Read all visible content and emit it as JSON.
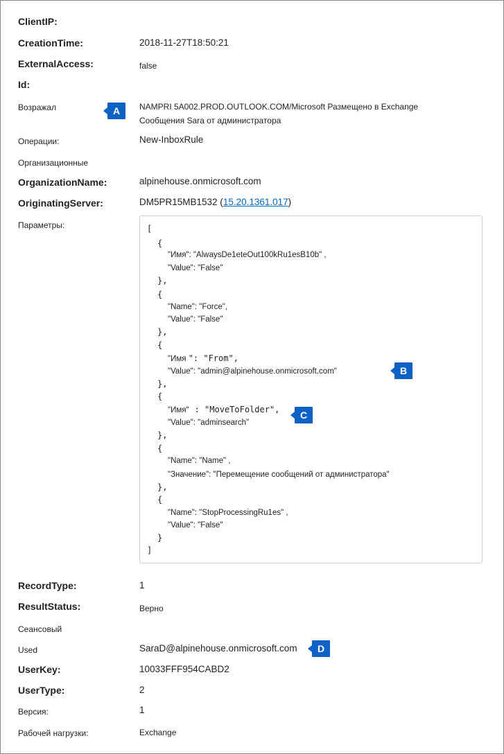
{
  "properties": {
    "client_ip": {
      "label": "ClientIP:"
    },
    "creation_time": {
      "label": "CreationTime:",
      "value": "2018-11-27T18:50:21"
    },
    "external_access": {
      "label": "ExternalAccess:",
      "value": "false"
    },
    "id": {
      "label": "Id:"
    },
    "objected": {
      "label": "Возражал",
      "value_line1": "NAMPRI 5A002.PROD.OUTLOOK.COM/Microsoft Размещено в Exchange",
      "value_line2": "Сообщения Sara от администратора"
    },
    "operations": {
      "label": "Операции:",
      "value": "New-InboxRule"
    },
    "organizational": {
      "label": "Организационные"
    },
    "organization_name": {
      "label": "OrganizationName:",
      "value": "alpinehouse.onmicrosoft.com"
    },
    "originating_server": {
      "label": "OriginatingServer:",
      "value_prefix": "DM5PR15MB1532 (",
      "value_link": "15.20.1361.017",
      "value_suffix": ")"
    },
    "parameters": {
      "label": "Параметры:"
    },
    "record_type": {
      "label": "RecordType:",
      "value": "1"
    },
    "result_status": {
      "label": "ResultStatus:",
      "value": "Верно"
    },
    "session": {
      "label": "Сеансовый"
    },
    "used": {
      "label": "Used",
      "value": "SaraD@alpinehouse.onmicrosoft.com"
    },
    "user_key": {
      "label": "UserKey:",
      "value": "10033FFF954CABD2"
    },
    "user_type": {
      "label": "UserType:",
      "value": "2"
    },
    "version": {
      "label": "Версия:",
      "value": "1"
    },
    "workload": {
      "label": "Рабочей нагрузки:",
      "value": "Exchange"
    }
  },
  "parameters_code": {
    "open_bracket": "[",
    "close_bracket": "]",
    "open_brace": "{",
    "close_brace": "}",
    "close_brace_comma": "},",
    "p1_name": "\"Имя\": \"AlwaysDe1eteOut100kRu1esB10b\" ,",
    "p1_value": "\"Value\": \"False\"",
    "p2_name": "\"Name\": \"Force\",",
    "p2_value": "\"Value\": \"False\"",
    "p3_name_a": "\"Имя ",
    "p3_name_b": "\": \"From\",",
    "p3_value": "\"Value\": \"admin@alpinehouse.onmicrosoft.com\"",
    "p4_name_a": "\"Имя\"",
    "p4_name_b": ": \"MoveToFolder\",",
    "p4_value": "\"Value\": \"adminsearch\"",
    "p5_name": "\"Name\": \"Name\" ,",
    "p5_value": "\"Значение\": \"Перемещение сообщений от администратора\"",
    "p6_name": "\"Name\": \"StopProcessingRu1es\" ,",
    "p6_value": "\"Value\": \"False\""
  },
  "callouts": {
    "a": "A",
    "b": "B",
    "c": "C",
    "d": "D"
  },
  "colors": {
    "callout": "#0e62c6",
    "link": "#0563c1"
  }
}
